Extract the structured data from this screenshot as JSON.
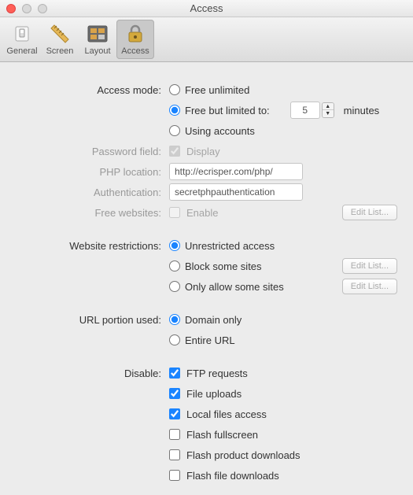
{
  "window": {
    "title": "Access"
  },
  "toolbar": {
    "general": "General",
    "screen": "Screen",
    "layout": "Layout",
    "access": "Access"
  },
  "accessMode": {
    "label": "Access mode:",
    "freeUnlimited": "Free unlimited",
    "freeLimited": "Free but limited to:",
    "minutesValue": "5",
    "minutesLabel": "minutes",
    "usingAccounts": "Using accounts",
    "passwordFieldLabel": "Password field:",
    "displayLabel": "Display",
    "phpLabel": "PHP location:",
    "phpValue": "http://ecrisper.com/php/",
    "authLabel": "Authentication:",
    "authValue": "secretphpauthentication",
    "freeWebsitesLabel": "Free websites:",
    "enableLabel": "Enable",
    "editList": "Edit List..."
  },
  "restrictions": {
    "label": "Website restrictions:",
    "unrestricted": "Unrestricted access",
    "blockSome": "Block some sites",
    "onlyAllow": "Only allow some sites",
    "editList": "Edit List..."
  },
  "urlPortion": {
    "label": "URL portion used:",
    "domainOnly": "Domain only",
    "entireUrl": "Entire URL"
  },
  "disable": {
    "label": "Disable:",
    "ftp": "FTP requests",
    "uploads": "File uploads",
    "local": "Local files access",
    "flashFull": "Flash fullscreen",
    "flashProd": "Flash product downloads",
    "flashFile": "Flash file downloads"
  }
}
